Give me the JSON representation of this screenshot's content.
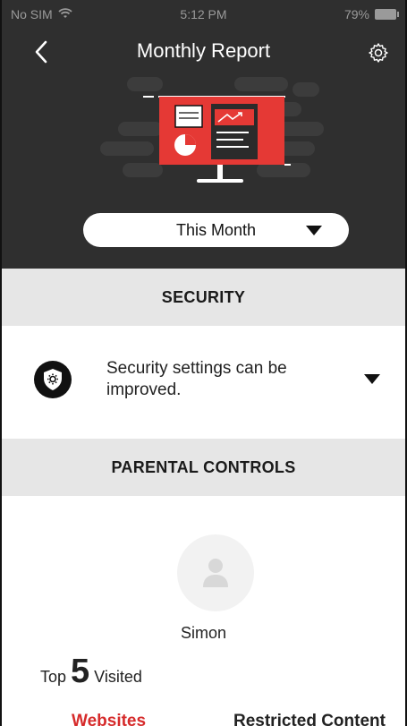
{
  "status_bar": {
    "carrier": "No SIM",
    "time": "5:12 PM",
    "battery": "79%"
  },
  "header": {
    "title": "Monthly Report"
  },
  "period_select": {
    "value": "This Month"
  },
  "security": {
    "section_title": "SECURITY",
    "message": "Security settings can be improved."
  },
  "parental_controls": {
    "section_title": "PARENTAL CONTROLS",
    "child_name": "Simon",
    "top_visited": {
      "prefix": "Top",
      "count": "5",
      "suffix": "Visited"
    },
    "tabs": [
      {
        "label": "Websites",
        "active": true
      },
      {
        "label": "Restricted Content",
        "active": false
      }
    ]
  },
  "colors": {
    "header_bg": "#2f2f2f",
    "accent_red": "#e53935",
    "section_bg": "#e6e6e6",
    "active_tab": "#d62b2b"
  },
  "icons": {
    "back": "chevron-left-icon",
    "settings": "gear-icon",
    "security": "shield-gear-icon",
    "avatar": "person-icon",
    "caret": "caret-down-icon",
    "wifi": "wifi-icon",
    "battery": "battery-icon"
  }
}
